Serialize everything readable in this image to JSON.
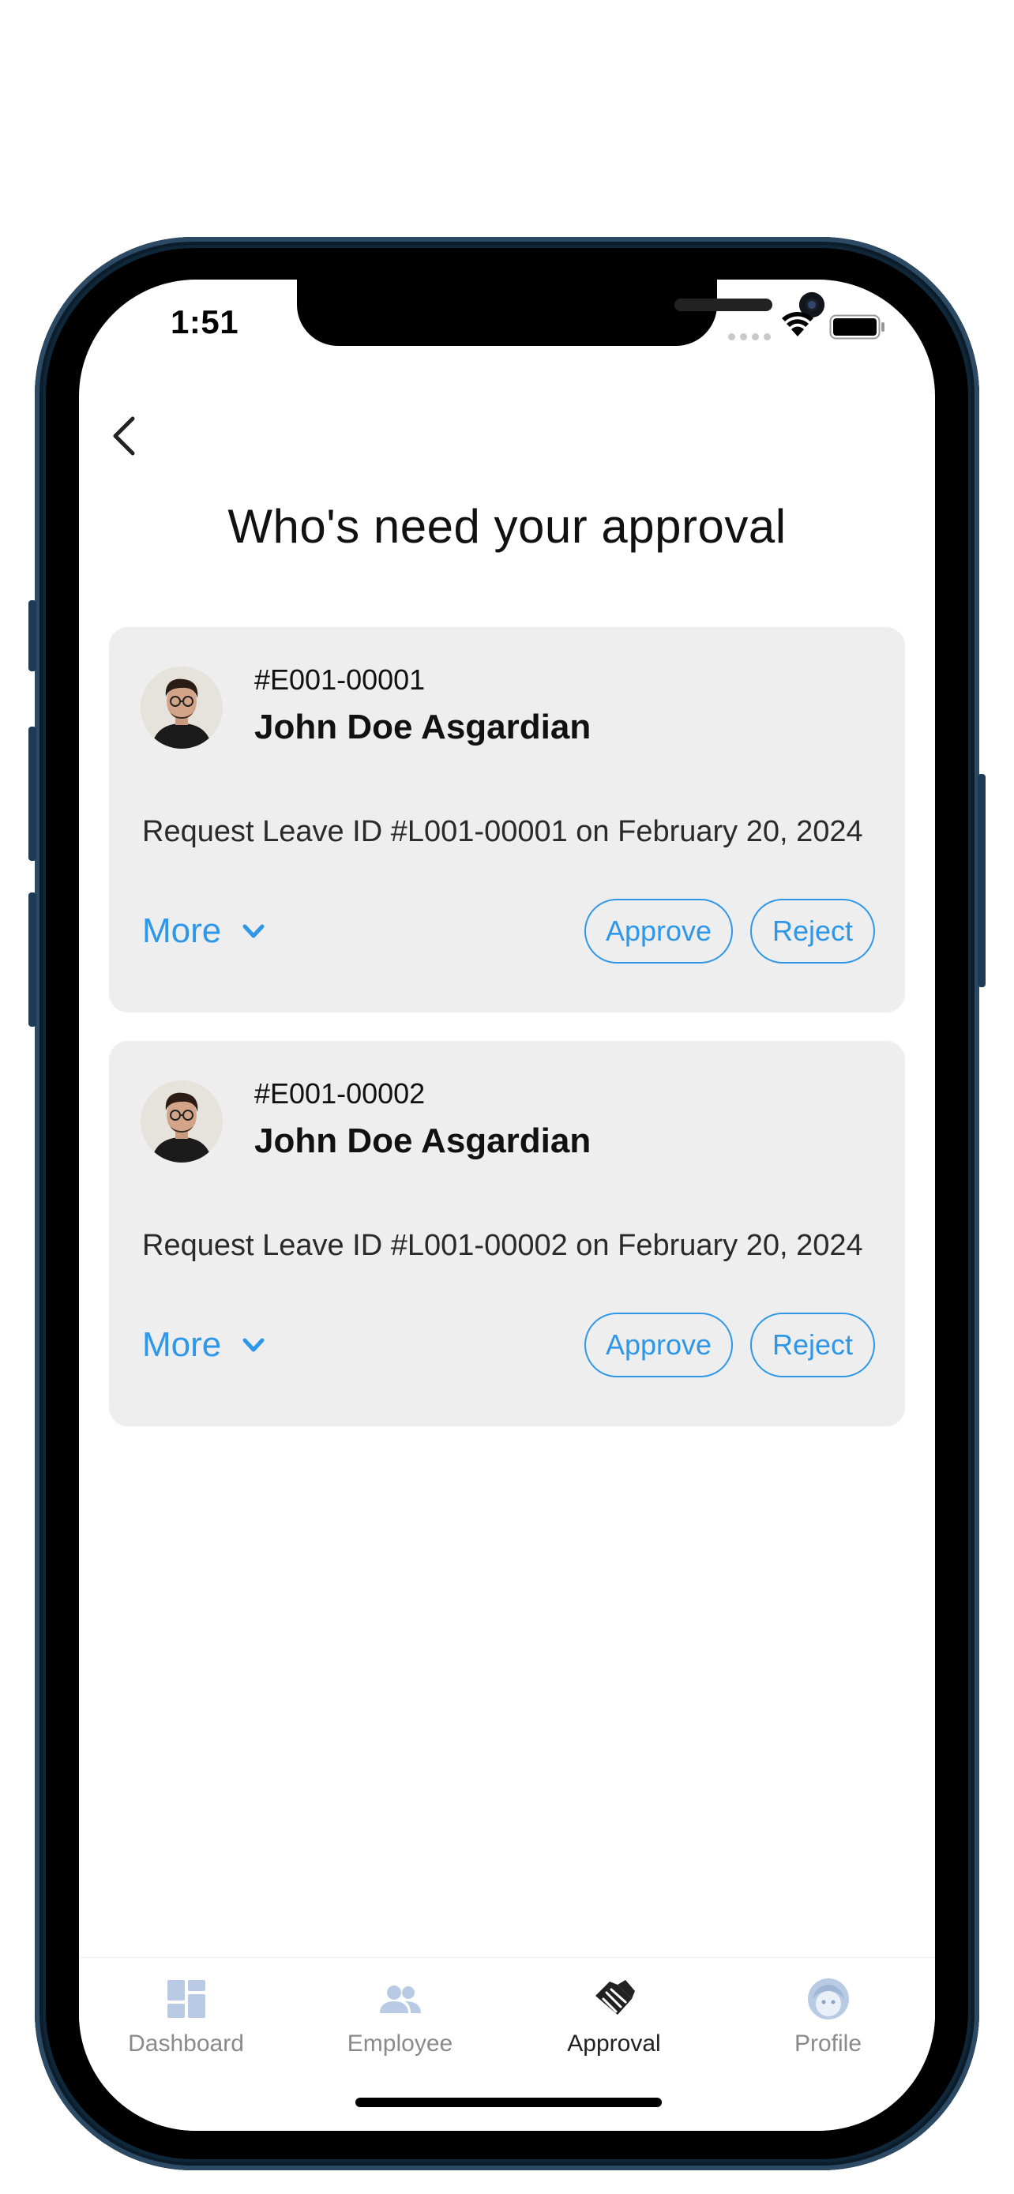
{
  "status_bar": {
    "time": "1:51"
  },
  "header": {
    "title": "Who's need your approval"
  },
  "requests": [
    {
      "employee_id": "#E001-00001",
      "name": "John Doe Asgardian",
      "request": "Request Leave ID #L001-00001 on February 20, 2024",
      "more_label": "More",
      "approve_label": "Approve",
      "reject_label": "Reject"
    },
    {
      "employee_id": "#E001-00002",
      "name": "John Doe Asgardian",
      "request": "Request Leave ID #L001-00002 on February 20, 2024",
      "more_label": "More",
      "approve_label": "Approve",
      "reject_label": "Reject"
    }
  ],
  "tabs": [
    {
      "label": "Dashboard",
      "icon": "dashboard-icon",
      "active": false
    },
    {
      "label": "Employee",
      "icon": "people-icon",
      "active": false
    },
    {
      "label": "Approval",
      "icon": "handshake-icon",
      "active": true
    },
    {
      "label": "Profile",
      "icon": "face-icon",
      "active": false
    }
  ],
  "colors": {
    "accent": "#2f97e8",
    "card_bg": "#eeeeee",
    "tab_inactive_icon": "#b9cbe4",
    "tab_active_icon": "#222222"
  }
}
